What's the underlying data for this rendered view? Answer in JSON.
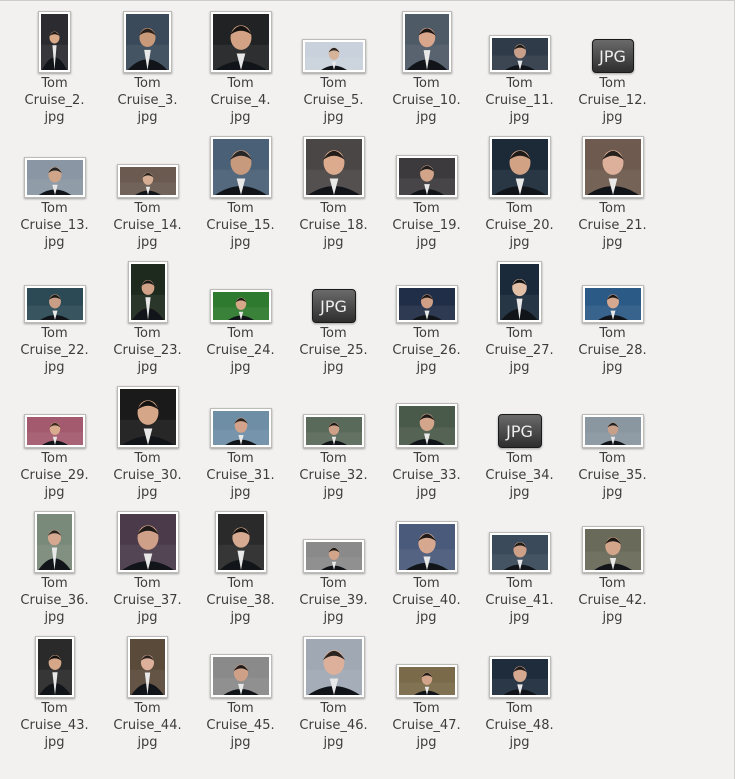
{
  "files": [
    {
      "line1": "Tom",
      "line2": "Cruise_2.",
      "line3": "jpg",
      "kind": "photo"
    },
    {
      "line1": "Tom",
      "line2": "Cruise_3.",
      "line3": "jpg",
      "kind": "photo"
    },
    {
      "line1": "Tom",
      "line2": "Cruise_4.",
      "line3": "jpg",
      "kind": "photo"
    },
    {
      "line1": "Tom",
      "line2": "Cruise_5.",
      "line3": "jpg",
      "kind": "photo"
    },
    {
      "line1": "Tom",
      "line2": "Cruise_10.",
      "line3": "jpg",
      "kind": "photo"
    },
    {
      "line1": "Tom",
      "line2": "Cruise_11.",
      "line3": "jpg",
      "kind": "photo"
    },
    {
      "line1": "Tom",
      "line2": "Cruise_12.",
      "line3": "jpg",
      "kind": "generic",
      "icon_text": "JPG"
    },
    {
      "line1": "Tom",
      "line2": "Cruise_13.",
      "line3": "jpg",
      "kind": "photo"
    },
    {
      "line1": "Tom",
      "line2": "Cruise_14.",
      "line3": "jpg",
      "kind": "photo"
    },
    {
      "line1": "Tom",
      "line2": "Cruise_15.",
      "line3": "jpg",
      "kind": "photo"
    },
    {
      "line1": "Tom",
      "line2": "Cruise_18.",
      "line3": "jpg",
      "kind": "photo"
    },
    {
      "line1": "Tom",
      "line2": "Cruise_19.",
      "line3": "jpg",
      "kind": "photo"
    },
    {
      "line1": "Tom",
      "line2": "Cruise_20.",
      "line3": "jpg",
      "kind": "photo"
    },
    {
      "line1": "Tom",
      "line2": "Cruise_21.",
      "line3": "jpg",
      "kind": "photo"
    },
    {
      "line1": "Tom",
      "line2": "Cruise_22.",
      "line3": "jpg",
      "kind": "photo"
    },
    {
      "line1": "Tom",
      "line2": "Cruise_23.",
      "line3": "jpg",
      "kind": "photo"
    },
    {
      "line1": "Tom",
      "line2": "Cruise_24.",
      "line3": "jpg",
      "kind": "photo"
    },
    {
      "line1": "Tom",
      "line2": "Cruise_25.",
      "line3": "jpg",
      "kind": "generic",
      "icon_text": "JPG"
    },
    {
      "line1": "Tom",
      "line2": "Cruise_26.",
      "line3": "jpg",
      "kind": "photo"
    },
    {
      "line1": "Tom",
      "line2": "Cruise_27.",
      "line3": "jpg",
      "kind": "photo"
    },
    {
      "line1": "Tom",
      "line2": "Cruise_28.",
      "line3": "jpg",
      "kind": "photo"
    },
    {
      "line1": "Tom",
      "line2": "Cruise_29.",
      "line3": "jpg",
      "kind": "photo"
    },
    {
      "line1": "Tom",
      "line2": "Cruise_30.",
      "line3": "jpg",
      "kind": "photo"
    },
    {
      "line1": "Tom",
      "line2": "Cruise_31.",
      "line3": "jpg",
      "kind": "photo"
    },
    {
      "line1": "Tom",
      "line2": "Cruise_32.",
      "line3": "jpg",
      "kind": "photo"
    },
    {
      "line1": "Tom",
      "line2": "Cruise_33.",
      "line3": "jpg",
      "kind": "photo"
    },
    {
      "line1": "Tom",
      "line2": "Cruise_34.",
      "line3": "jpg",
      "kind": "generic",
      "icon_text": "JPG"
    },
    {
      "line1": "Tom",
      "line2": "Cruise_35.",
      "line3": "jpg",
      "kind": "photo"
    },
    {
      "line1": "Tom",
      "line2": "Cruise_36.",
      "line3": "jpg",
      "kind": "photo"
    },
    {
      "line1": "Tom",
      "line2": "Cruise_37.",
      "line3": "jpg",
      "kind": "photo"
    },
    {
      "line1": "Tom",
      "line2": "Cruise_38.",
      "line3": "jpg",
      "kind": "photo"
    },
    {
      "line1": "Tom",
      "line2": "Cruise_39.",
      "line3": "jpg",
      "kind": "photo"
    },
    {
      "line1": "Tom",
      "line2": "Cruise_40.",
      "line3": "jpg",
      "kind": "photo"
    },
    {
      "line1": "Tom",
      "line2": "Cruise_41.",
      "line3": "jpg",
      "kind": "photo"
    },
    {
      "line1": "Tom",
      "line2": "Cruise_42.",
      "line3": "jpg",
      "kind": "photo"
    },
    {
      "line1": "Tom",
      "line2": "Cruise_43.",
      "line3": "jpg",
      "kind": "photo"
    },
    {
      "line1": "Tom",
      "line2": "Cruise_44.",
      "line3": "jpg",
      "kind": "photo"
    },
    {
      "line1": "Tom",
      "line2": "Cruise_45.",
      "line3": "jpg",
      "kind": "photo"
    },
    {
      "line1": "Tom",
      "line2": "Cruise_46.",
      "line3": "jpg",
      "kind": "photo"
    },
    {
      "line1": "Tom",
      "line2": "Cruise_47.",
      "line3": "jpg",
      "kind": "photo"
    },
    {
      "line1": "Tom",
      "line2": "Cruise_48.",
      "line3": "jpg",
      "kind": "photo"
    }
  ]
}
